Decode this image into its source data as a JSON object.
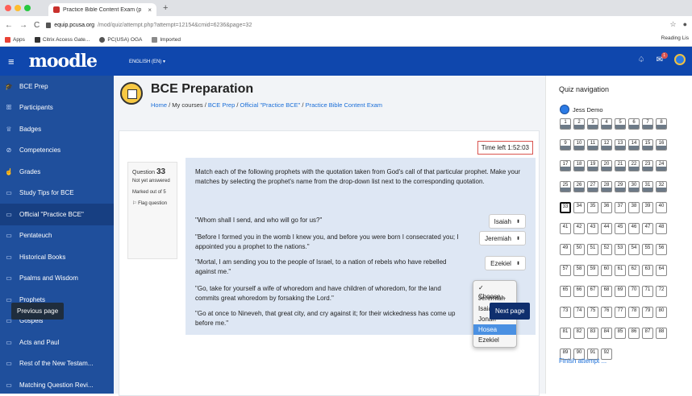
{
  "browser": {
    "tab_title": "Practice Bible Content Exam (p",
    "tab_close": "×",
    "new_tab": "+",
    "url_host": "equip.pcusa.org",
    "url_path": "/mod/quiz/attempt.php?attempt=12154&cmid=6236&page=32",
    "back": "←",
    "forward": "→",
    "reload": "C",
    "star": "☆",
    "bookmarks": [
      "Apps",
      "Citrix Access Gate...",
      "PC(USA) OGA",
      "Imported"
    ],
    "reading_list": "Reading Lis"
  },
  "topnav": {
    "logo": "moodle",
    "language": "ENGLISH (EN) ▾",
    "notif_count": "1"
  },
  "sidebar": {
    "items": [
      {
        "label": "BCE Prep",
        "icon": "graduation-cap-icon"
      },
      {
        "label": "Participants",
        "icon": "users-icon"
      },
      {
        "label": "Badges",
        "icon": "badge-icon"
      },
      {
        "label": "Competencies",
        "icon": "check-circle-icon"
      },
      {
        "label": "Grades",
        "icon": "thumbs-up-icon"
      },
      {
        "label": "Study Tips for BCE",
        "icon": "folder-icon"
      },
      {
        "label": "Official \"Practice BCE\"",
        "icon": "folder-icon"
      },
      {
        "label": "Pentateuch",
        "icon": "folder-icon"
      },
      {
        "label": "Historical Books",
        "icon": "folder-icon"
      },
      {
        "label": "Psalms and Wisdom",
        "icon": "folder-icon"
      },
      {
        "label": "Prophets",
        "icon": "folder-icon"
      },
      {
        "label": "Gospels",
        "icon": "folder-icon"
      },
      {
        "label": "Acts and Paul",
        "icon": "folder-icon"
      },
      {
        "label": "Rest of the New Testam...",
        "icon": "folder-icon"
      },
      {
        "label": "Matching Question Revi...",
        "icon": "folder-icon"
      }
    ],
    "active_index": 6
  },
  "page": {
    "title": "BCE Preparation",
    "breadcrumb": [
      "Home",
      "My courses",
      "BCE Prep",
      "Official \"Practice BCE\"",
      "Practice Bible Content Exam"
    ]
  },
  "question": {
    "label": "Question",
    "number": "33",
    "status": "Not yet answered",
    "marks": "Marked out of 5",
    "flag": "Flag question",
    "timer": "Time left 1:52:03",
    "prompt": "Match each of the following prophets with the quotation taken from God's call of that particular prophet. Make your matches by selecting the prophet's name from the drop-down list next to the corresponding quotation.",
    "rows": [
      {
        "quote": "\"Whom shall I send, and who will go for us?\"",
        "answer": "Isaiah"
      },
      {
        "quote": "\"Before I formed you in the womb I knew you, and before you were born I consecrated you; I appointed you a prophet to the nations.\"",
        "answer": "Jeremiah"
      },
      {
        "quote": "\"Mortal, I am sending you to the people of Israel, to a nation of rebels who have rebelled against me.\"",
        "answer": "Ezekiel"
      },
      {
        "quote": "\"Go, take for yourself a wife of whoredom and have children of whoredom, for the land commits great whoredom by forsaking the Lord.\"",
        "answer": ""
      },
      {
        "quote": "\"Go at once to Nineveh, that great city, and cry against it; for their wickedness has come up before me.\"",
        "answer": ""
      }
    ],
    "dropdown": [
      "✓ Choose...",
      "Jeremiah",
      "Isaiah",
      "Jonah",
      "Hosea",
      "Ezekiel"
    ],
    "dropdown_highlight": 4
  },
  "buttons": {
    "previous": "Previous page",
    "next": "Next page"
  },
  "quiz_nav": {
    "title": "Quiz navigation",
    "user": "Jess Demo",
    "current": 33,
    "total": 92,
    "finish": "Finish attempt ..."
  }
}
